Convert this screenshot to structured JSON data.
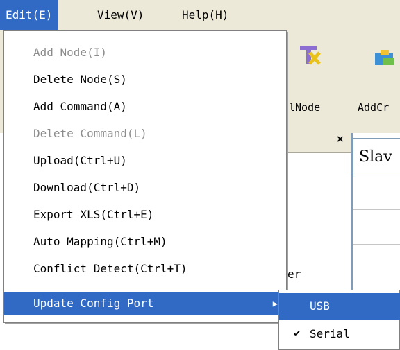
{
  "menubar": {
    "items": [
      {
        "label": "Edit(E)"
      },
      {
        "label": "View(V)"
      },
      {
        "label": "Help(H)"
      }
    ]
  },
  "toolbar": {
    "labels": [
      "lNode",
      "AddCr"
    ]
  },
  "pane": {
    "close_glyph": "×",
    "behind_text": "er"
  },
  "grid": {
    "header": "Slav"
  },
  "edit_menu": {
    "items": [
      {
        "label": "Add Node(I)",
        "enabled": false
      },
      {
        "label": "Delete Node(S)",
        "enabled": true
      },
      {
        "label": "Add Command(A)",
        "enabled": true
      },
      {
        "label": "Delete Command(L)",
        "enabled": false
      },
      {
        "label": "Upload(Ctrl+U)",
        "enabled": true
      },
      {
        "label": "Download(Ctrl+D)",
        "enabled": true
      },
      {
        "label": "Export XLS(Ctrl+E)",
        "enabled": true
      },
      {
        "label": "Auto Mapping(Ctrl+M)",
        "enabled": true
      },
      {
        "label": "Conflict Detect(Ctrl+T)",
        "enabled": true
      },
      {
        "label": "Update Config Port",
        "enabled": true,
        "submenu_arrow": "▶"
      }
    ]
  },
  "submenu": {
    "items": [
      {
        "label": "USB",
        "checked": ""
      },
      {
        "label": "Serial",
        "checked": "✔"
      }
    ]
  },
  "colors": {
    "highlight": "#316ac5",
    "menu_bg": "#ece9d8",
    "disabled_text": "#8c8c8c"
  }
}
